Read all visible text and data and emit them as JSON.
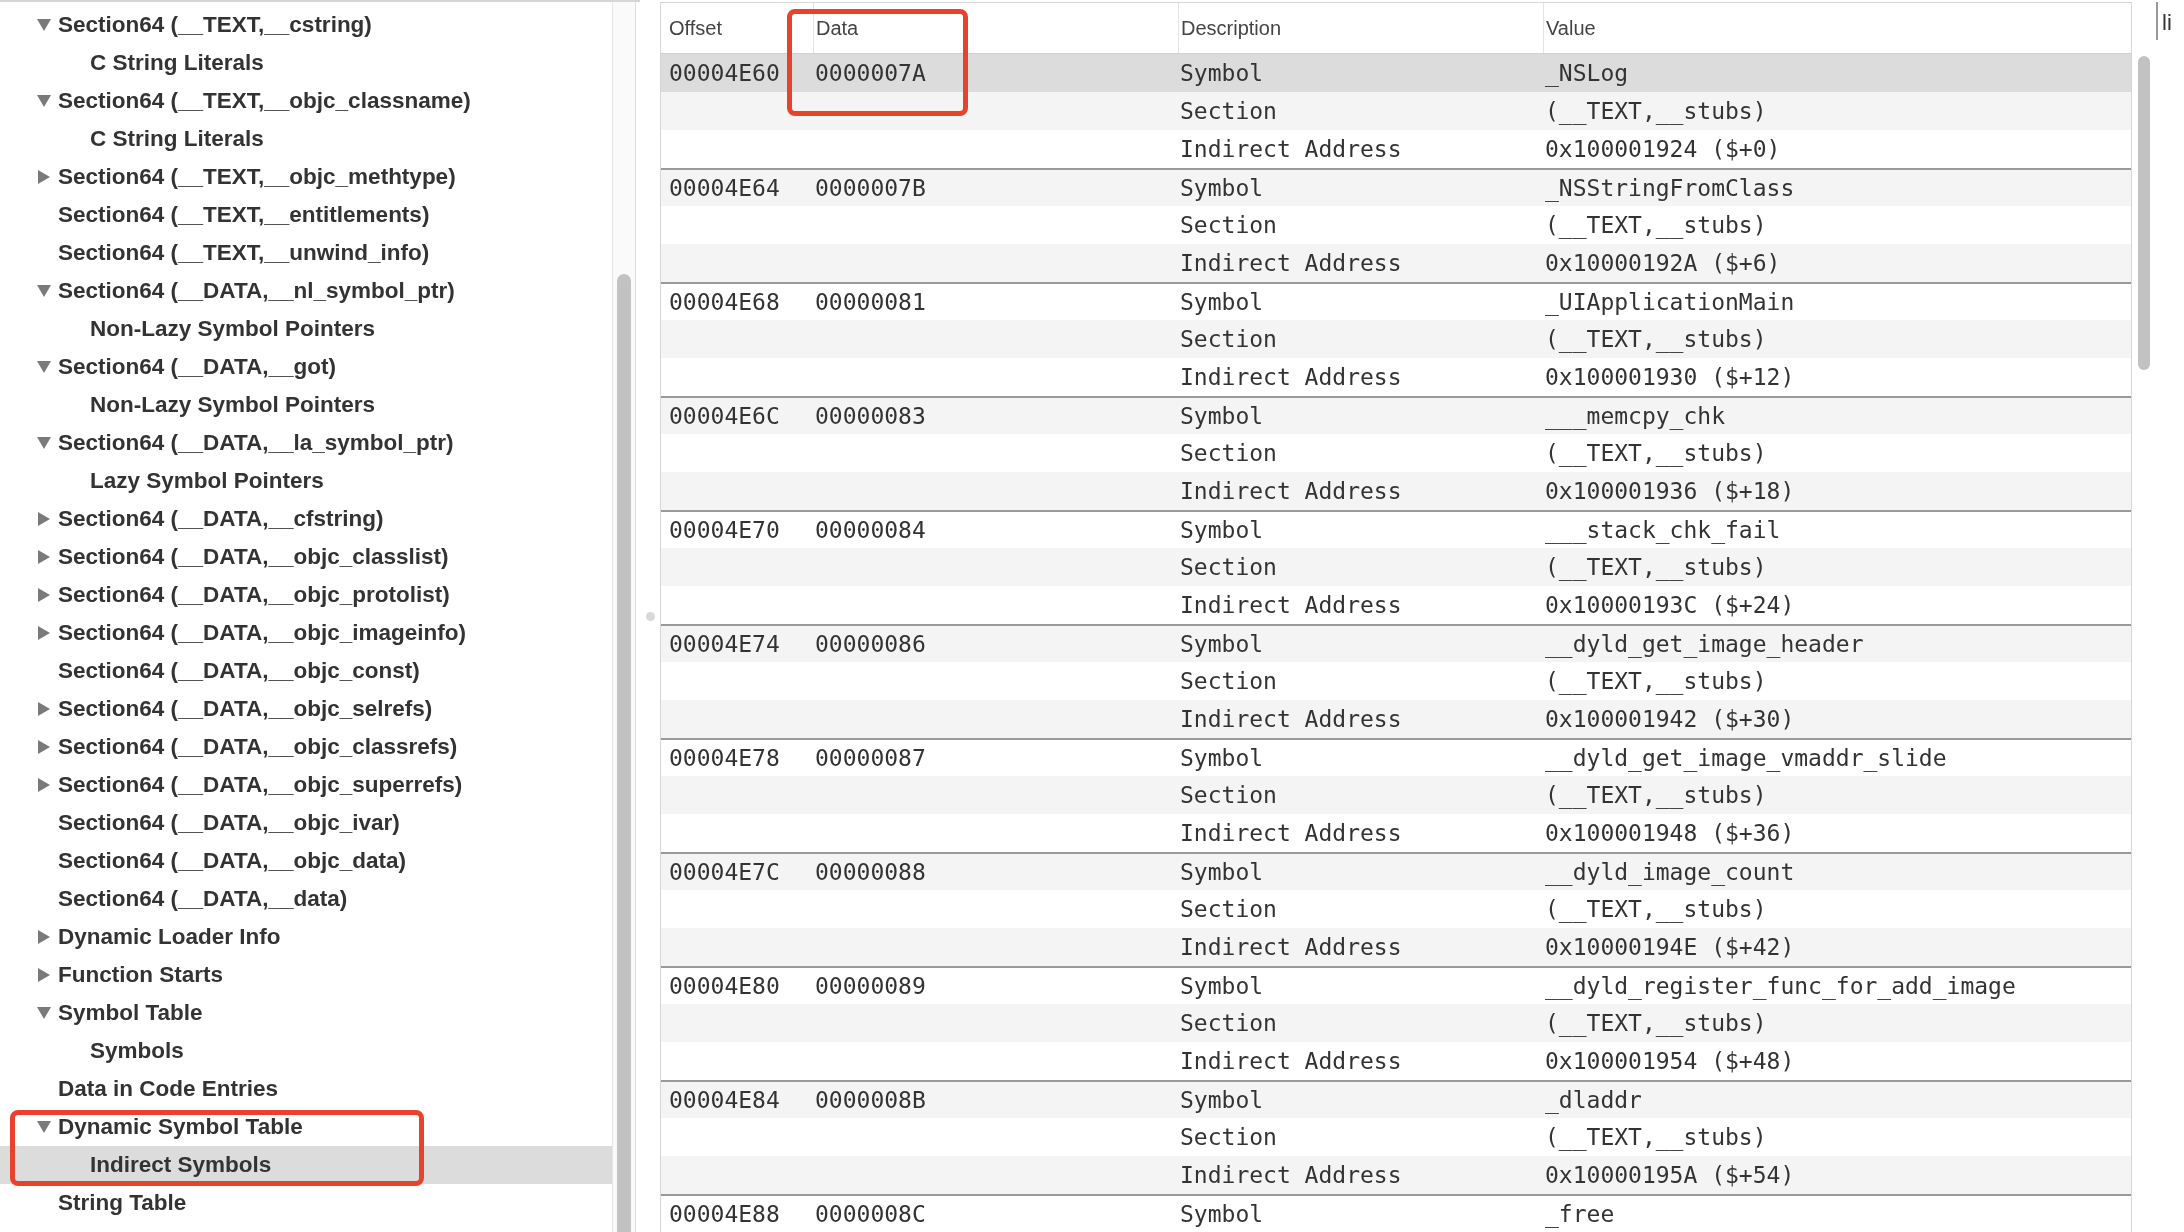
{
  "tree": [
    {
      "label": "Section64 (__TEXT,__cstring)",
      "expanded": true,
      "selected": false,
      "children": [
        {
          "label": "C String Literals",
          "selected": false
        }
      ]
    },
    {
      "label": "Section64 (__TEXT,__objc_classname)",
      "expanded": true,
      "selected": false,
      "children": [
        {
          "label": "C String Literals",
          "selected": false
        }
      ]
    },
    {
      "label": "Section64 (__TEXT,__objc_methtype)",
      "expanded": false,
      "selected": false
    },
    {
      "label": "Section64 (__TEXT,__entitlements)",
      "selected": false
    },
    {
      "label": "Section64 (__TEXT,__unwind_info)",
      "selected": false
    },
    {
      "label": "Section64 (__DATA,__nl_symbol_ptr)",
      "expanded": true,
      "selected": false,
      "children": [
        {
          "label": "Non-Lazy Symbol Pointers",
          "selected": false
        }
      ]
    },
    {
      "label": "Section64 (__DATA,__got)",
      "expanded": true,
      "selected": false,
      "children": [
        {
          "label": "Non-Lazy Symbol Pointers",
          "selected": false
        }
      ]
    },
    {
      "label": "Section64 (__DATA,__la_symbol_ptr)",
      "expanded": true,
      "selected": false,
      "children": [
        {
          "label": "Lazy Symbol Pointers",
          "selected": false
        }
      ]
    },
    {
      "label": "Section64 (__DATA,__cfstring)",
      "expanded": false,
      "selected": false
    },
    {
      "label": "Section64 (__DATA,__objc_classlist)",
      "expanded": false,
      "selected": false
    },
    {
      "label": "Section64 (__DATA,__objc_protolist)",
      "expanded": false,
      "selected": false
    },
    {
      "label": "Section64 (__DATA,__objc_imageinfo)",
      "expanded": false,
      "selected": false
    },
    {
      "label": "Section64 (__DATA,__objc_const)",
      "selected": false
    },
    {
      "label": "Section64 (__DATA,__objc_selrefs)",
      "expanded": false,
      "selected": false
    },
    {
      "label": "Section64 (__DATA,__objc_classrefs)",
      "expanded": false,
      "selected": false
    },
    {
      "label": "Section64 (__DATA,__objc_superrefs)",
      "expanded": false,
      "selected": false
    },
    {
      "label": "Section64 (__DATA,__objc_ivar)",
      "selected": false
    },
    {
      "label": "Section64 (__DATA,__objc_data)",
      "selected": false
    },
    {
      "label": "Section64 (__DATA,__data)",
      "selected": false
    },
    {
      "label": "Dynamic Loader Info",
      "expanded": false,
      "selected": false
    },
    {
      "label": "Function Starts",
      "expanded": false,
      "selected": false
    },
    {
      "label": "Symbol Table",
      "expanded": true,
      "selected": false,
      "children": [
        {
          "label": "Symbols",
          "selected": false
        }
      ]
    },
    {
      "label": "Data in Code Entries",
      "selected": false
    },
    {
      "label": "Dynamic Symbol Table",
      "expanded": true,
      "selected": false,
      "outlined": true,
      "children": [
        {
          "label": "Indirect Symbols",
          "selected": true
        }
      ]
    },
    {
      "label": "String Table",
      "selected": false
    }
  ],
  "table": {
    "columns": [
      {
        "label": "Offset",
        "outlined": false
      },
      {
        "label": "Data",
        "outlined": true
      },
      {
        "label": "Description",
        "outlined": false
      },
      {
        "label": "Value",
        "outlined": false
      }
    ],
    "groups": [
      {
        "offset": "00004E60",
        "data": "0000007A",
        "entries": [
          {
            "description": "Symbol",
            "value": "_NSLog",
            "selected": true
          },
          {
            "description": "Section",
            "value": "(__TEXT,__stubs)",
            "selected": false
          },
          {
            "description": "Indirect Address",
            "value": "0x100001924 ($+0)",
            "selected": false
          }
        ]
      },
      {
        "offset": "00004E64",
        "data": "0000007B",
        "entries": [
          {
            "description": "Symbol",
            "value": "_NSStringFromClass",
            "selected": false
          },
          {
            "description": "Section",
            "value": "(__TEXT,__stubs)",
            "selected": false
          },
          {
            "description": "Indirect Address",
            "value": "0x10000192A ($+6)",
            "selected": false
          }
        ]
      },
      {
        "offset": "00004E68",
        "data": "00000081",
        "entries": [
          {
            "description": "Symbol",
            "value": "_UIApplicationMain",
            "selected": false
          },
          {
            "description": "Section",
            "value": "(__TEXT,__stubs)",
            "selected": false
          },
          {
            "description": "Indirect Address",
            "value": "0x100001930 ($+12)",
            "selected": false
          }
        ]
      },
      {
        "offset": "00004E6C",
        "data": "00000083",
        "entries": [
          {
            "description": "Symbol",
            "value": "___memcpy_chk",
            "selected": false
          },
          {
            "description": "Section",
            "value": "(__TEXT,__stubs)",
            "selected": false
          },
          {
            "description": "Indirect Address",
            "value": "0x100001936 ($+18)",
            "selected": false
          }
        ]
      },
      {
        "offset": "00004E70",
        "data": "00000084",
        "entries": [
          {
            "description": "Symbol",
            "value": "___stack_chk_fail",
            "selected": false
          },
          {
            "description": "Section",
            "value": "(__TEXT,__stubs)",
            "selected": false
          },
          {
            "description": "Indirect Address",
            "value": "0x10000193C ($+24)",
            "selected": false
          }
        ]
      },
      {
        "offset": "00004E74",
        "data": "00000086",
        "entries": [
          {
            "description": "Symbol",
            "value": "__dyld_get_image_header",
            "selected": false
          },
          {
            "description": "Section",
            "value": "(__TEXT,__stubs)",
            "selected": false
          },
          {
            "description": "Indirect Address",
            "value": "0x100001942 ($+30)",
            "selected": false
          }
        ]
      },
      {
        "offset": "00004E78",
        "data": "00000087",
        "entries": [
          {
            "description": "Symbol",
            "value": "__dyld_get_image_vmaddr_slide",
            "selected": false
          },
          {
            "description": "Section",
            "value": "(__TEXT,__stubs)",
            "selected": false
          },
          {
            "description": "Indirect Address",
            "value": "0x100001948 ($+36)",
            "selected": false
          }
        ]
      },
      {
        "offset": "00004E7C",
        "data": "00000088",
        "entries": [
          {
            "description": "Symbol",
            "value": "__dyld_image_count",
            "selected": false
          },
          {
            "description": "Section",
            "value": "(__TEXT,__stubs)",
            "selected": false
          },
          {
            "description": "Indirect Address",
            "value": "0x10000194E ($+42)",
            "selected": false
          }
        ]
      },
      {
        "offset": "00004E80",
        "data": "00000089",
        "entries": [
          {
            "description": "Symbol",
            "value": "__dyld_register_func_for_add_image",
            "selected": false
          },
          {
            "description": "Section",
            "value": "(__TEXT,__stubs)",
            "selected": false
          },
          {
            "description": "Indirect Address",
            "value": "0x100001954 ($+48)",
            "selected": false
          }
        ]
      },
      {
        "offset": "00004E84",
        "data": "0000008B",
        "entries": [
          {
            "description": "Symbol",
            "value": "_dladdr",
            "selected": false
          },
          {
            "description": "Section",
            "value": "(__TEXT,__stubs)",
            "selected": false
          },
          {
            "description": "Indirect Address",
            "value": "0x10000195A ($+54)",
            "selected": false
          }
        ]
      },
      {
        "offset": "00004E88",
        "data": "0000008C",
        "entries": [
          {
            "description": "Symbol",
            "value": "_free",
            "selected": false
          }
        ]
      }
    ]
  },
  "side_label": "li"
}
